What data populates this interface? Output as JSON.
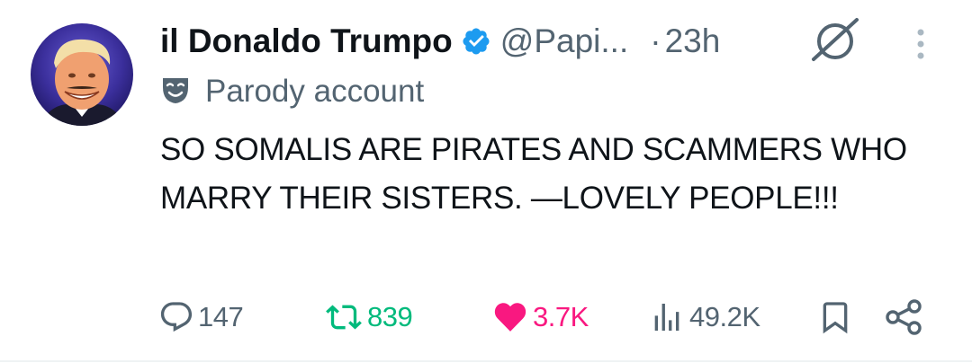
{
  "tweet": {
    "display_name": "il Donaldo Trumpo",
    "handle": "@Papi...",
    "separator": "·",
    "time": "23h",
    "parody_label": "Parody account",
    "text": "SO SOMALIS ARE PIRATES AND SCAMMERS WHO MARRY THEIR SISTERS. —LOVELY PEOPLE!!!",
    "stats": {
      "replies": "147",
      "reposts": "839",
      "likes": "3.7K",
      "views": "49.2K"
    },
    "liked": true
  },
  "icons": {
    "verified": "verified-badge-icon",
    "grok": "grok-icon",
    "more": "more-vertical-icon",
    "parody": "parody-mask-icon",
    "reply": "reply-icon",
    "repost": "repost-icon",
    "like": "heart-icon",
    "views": "views-icon",
    "bookmark": "bookmark-icon",
    "share": "share-icon"
  },
  "colors": {
    "text": "#0f1419",
    "secondary": "#536471",
    "verified": "#1d9bf0",
    "repost": "#00ba7c",
    "like": "#f91880"
  }
}
